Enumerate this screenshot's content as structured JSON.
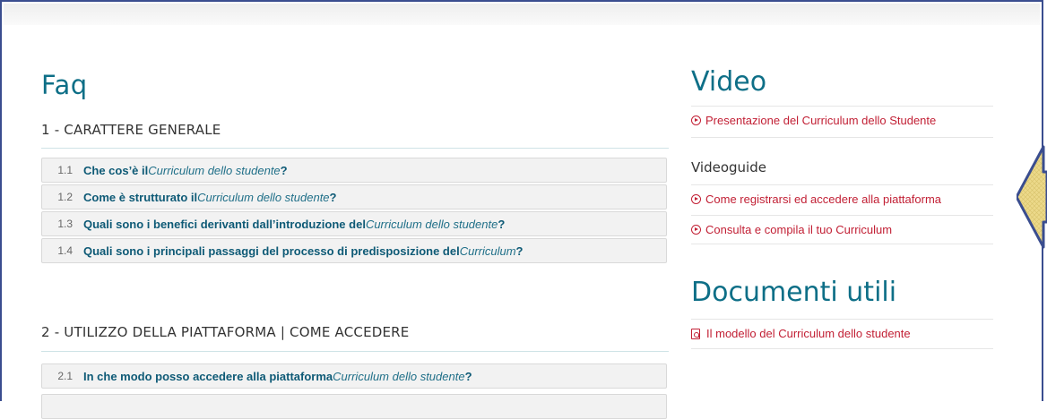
{
  "faq": {
    "title": "Faq",
    "sections": [
      {
        "heading": "1 - CARATTERE GENERALE",
        "items": [
          {
            "num": "1.1",
            "text": "Che cos’è il ",
            "italic": "Curriculum dello studente",
            "suffix": "?"
          },
          {
            "num": "1.2",
            "text": "Come è strutturato il ",
            "italic": "Curriculum dello studente",
            "suffix": "?"
          },
          {
            "num": "1.3",
            "text": "Quali sono i benefici derivanti dall’introduzione del ",
            "italic": "Curriculum dello studente",
            "suffix": "?"
          },
          {
            "num": "1.4",
            "text": "Quali sono i principali passaggi del processo di predisposizione del ",
            "italic": "Curriculum",
            "suffix": "?"
          }
        ]
      },
      {
        "heading": "2 - UTILIZZO DELLA PIATTAFORMA | COME ACCEDERE",
        "items": [
          {
            "num": "2.1",
            "text": "In che modo posso accedere alla piattaforma ",
            "italic": "Curriculum dello studente",
            "suffix": "?"
          }
        ]
      }
    ]
  },
  "video": {
    "title": "Video",
    "links": [
      "Presentazione del Curriculum dello Studente"
    ],
    "subheading": "Videoguide",
    "guides": [
      "Come registrarsi ed accedere alla piattaforma",
      "Consulta e compila il tuo Curriculum"
    ]
  },
  "documenti": {
    "title": "Documenti utili",
    "links": [
      "Il modello del Curriculum dello studente"
    ]
  },
  "colors": {
    "accent": "#0e6f87",
    "link": "#c22035",
    "arrow_fill": "#e9d78a",
    "arrow_stroke": "#3a4d8f"
  }
}
